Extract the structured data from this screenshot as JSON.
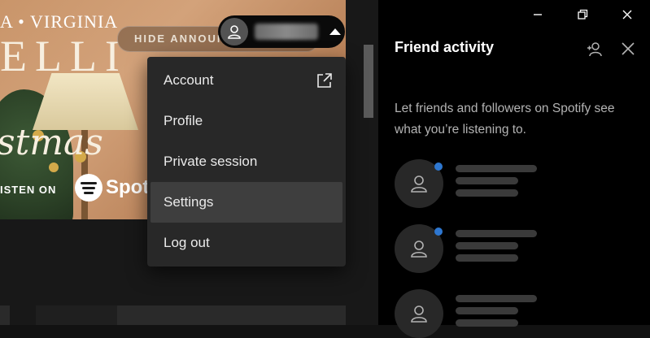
{
  "banner": {
    "title": "A • VIRGINIA",
    "big_text": "ELLI",
    "script_text": "stmas",
    "listen_text": "ISTEN ON",
    "brand_text": "Spoti",
    "hide_button_label": "HIDE ANNOUNCEMENT"
  },
  "user_menu": {
    "items": [
      {
        "label": "Account",
        "icon": "external-link-icon",
        "active": false
      },
      {
        "label": "Profile",
        "active": false
      },
      {
        "label": "Private session",
        "active": false
      },
      {
        "label": "Settings",
        "active": true
      },
      {
        "label": "Log out",
        "active": false
      }
    ]
  },
  "window_controls": [
    "minimize-icon",
    "restore-icon",
    "close-icon"
  ],
  "friend_activity": {
    "title": "Friend activity",
    "description": "Let friends and followers on Spotify see what you’re listening to.",
    "friends": [
      {
        "online": true
      },
      {
        "online": true
      },
      {
        "online": false
      }
    ]
  },
  "colors": {
    "accent_blue": "#2e77d0",
    "panel_bg": "#000000",
    "menu_bg": "#282828",
    "menu_active": "#3e3e3e"
  }
}
